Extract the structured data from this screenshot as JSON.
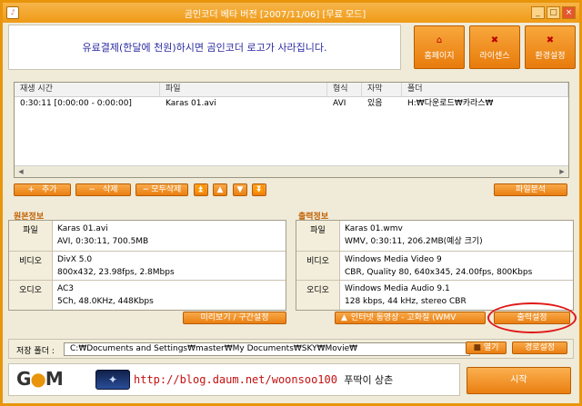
{
  "window": {
    "title": "곰인코더 베타 버전 [2007/11/06] [무료 모드]",
    "btn_min": "_",
    "btn_max": "□",
    "btn_close": "×"
  },
  "promo": "유료결제(한달에 천원)하시면 곰인코더 로고가 사라집니다.",
  "top_buttons": {
    "homepage": "홈페이지",
    "license": "라이센스",
    "settings": "환경설정"
  },
  "filelist": {
    "headers": [
      "재생 시간",
      "파일",
      "형식",
      "자막",
      "폴더"
    ],
    "rows": [
      {
        "time": "0:30:11 [0:00:00 - 0:00:00]",
        "file": "Karas 01.avi",
        "format": "AVI",
        "subtitle": "있음",
        "folder": "H:₩다운로드₩카라스₩"
      }
    ]
  },
  "list_buttons": {
    "add": "추가",
    "delete": "삭제",
    "delete_all": "모두삭제",
    "analyze": "파일분석"
  },
  "source": {
    "title": "원본정보",
    "file_label": "파일",
    "file_name": "Karas 01.avi",
    "file_detail": "AVI, 0:30:11, 700.5MB",
    "video_label": "비디오",
    "video_codec": "DivX 5.0",
    "video_detail": "800x432, 23.98fps, 2.8Mbps",
    "audio_label": "오디오",
    "audio_codec": "AC3",
    "audio_detail": "5Ch, 48.0KHz, 448Kbps",
    "preview_button": "미리보기 / 구간설정"
  },
  "output": {
    "title": "출력정보",
    "file_label": "파일",
    "file_name": "Karas 01.wmv",
    "file_detail": "WMV, 0:30:11, 206.2MB(예상 크기)",
    "video_label": "비디오",
    "video_codec": "Windows Media Video 9",
    "video_detail": "CBR, Quality 80, 640x345, 24.00fps, 800Kbps",
    "audio_label": "오디오",
    "audio_codec": "Windows Media Audio 9.1",
    "audio_detail": "128 kbps, 44 kHz, stereo CBR",
    "preset_button": "인터넷 동영상 - 고화질 (WMV",
    "output_settings_button": "출력설정"
  },
  "save_folder": {
    "label": "저장 폴더 :",
    "path": "C:₩Documents and Settings₩master₩My Documents₩SKY₩Movie₩",
    "open_button": "열기",
    "path_settings_button": "경로설정"
  },
  "banner": {
    "logo": "GOM",
    "url": "http://blog.daum.net/woonsoo100",
    "tag": "푸딱이 상촌"
  },
  "start_button": "시작"
}
